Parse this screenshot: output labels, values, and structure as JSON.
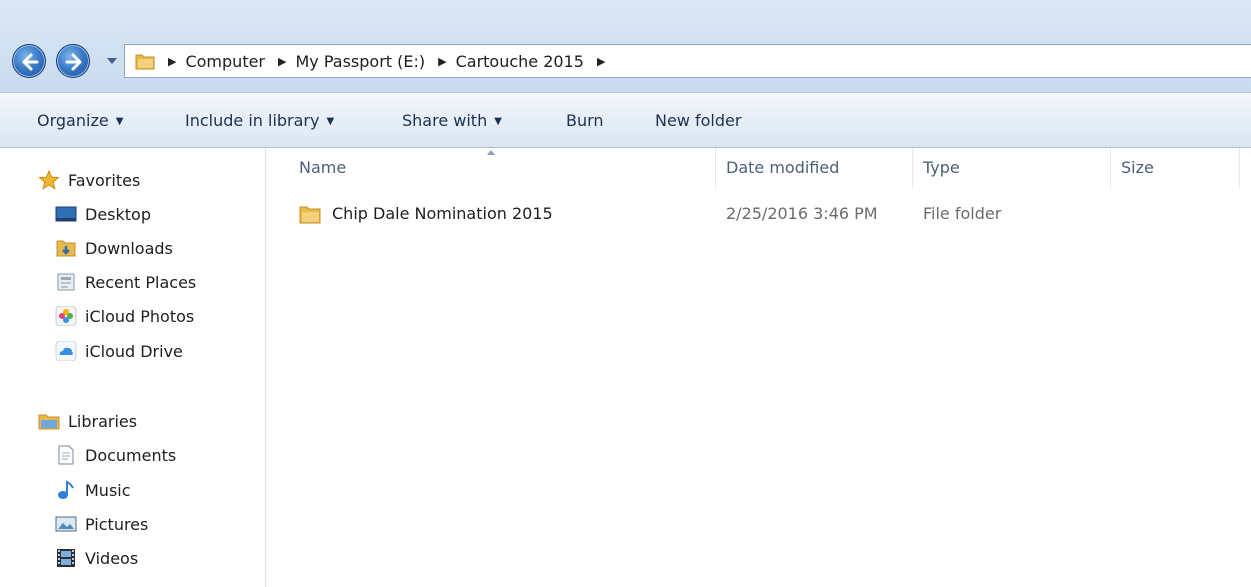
{
  "address_bar": {
    "breadcrumbs": [
      "Computer",
      "My Passport (E:)",
      "Cartouche 2015"
    ]
  },
  "toolbar": {
    "organize": "Organize",
    "include_in_library": "Include in library",
    "share_with": "Share with",
    "burn": "Burn",
    "new_folder": "New folder"
  },
  "nav_pane": {
    "favorites": {
      "label": "Favorites",
      "items": [
        "Desktop",
        "Downloads",
        "Recent Places",
        "iCloud Photos",
        "iCloud Drive"
      ]
    },
    "libraries": {
      "label": "Libraries",
      "items": [
        "Documents",
        "Music",
        "Pictures",
        "Videos"
      ]
    }
  },
  "file_list": {
    "columns": [
      "Name",
      "Date modified",
      "Type",
      "Size"
    ],
    "sort_column": "Name",
    "rows": [
      {
        "name": "Chip Dale Nomination 2015",
        "date_modified": "2/25/2016 3:46 PM",
        "type": "File folder",
        "size": ""
      }
    ]
  },
  "icons": {
    "back": "back-arrow-icon",
    "forward": "forward-arrow-icon",
    "folder": "folder-icon",
    "favorites": "star-icon",
    "libraries": "library-icon"
  },
  "colors": {
    "title_bg": "#d3e2f2",
    "toolbar_bg": "#e6eef8",
    "nav_button": "#3a7bc8",
    "folder": "#e9b94a",
    "header_text": "#4c607a",
    "meta_text": "#6b6b6b"
  }
}
